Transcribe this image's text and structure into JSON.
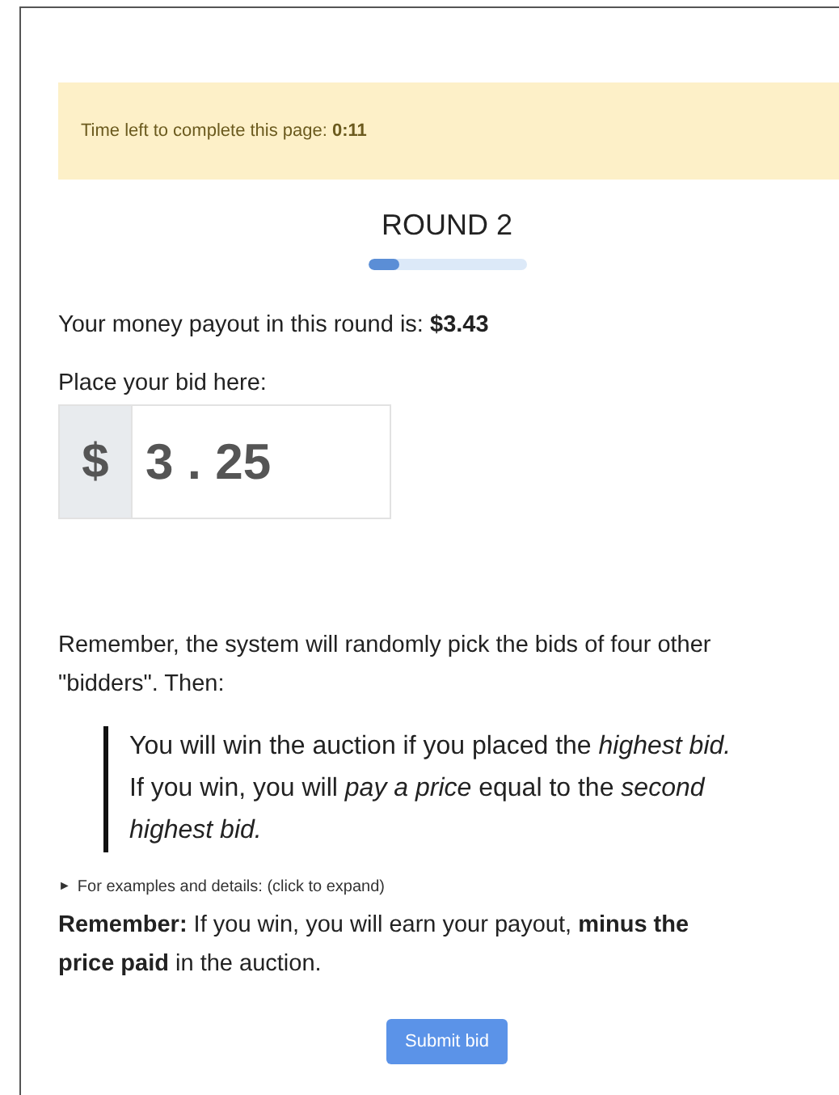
{
  "alert": {
    "text": "Time left to complete this page: **0:11**"
  },
  "round": {
    "title": "ROUND 2",
    "level": 0.2
  },
  "payout": {
    "text": "Your money payout in this round is: **$3.43**"
  },
  "bid": {
    "label": "Place your bid here:",
    "prefix": "$",
    "value": "3 . 25"
  },
  "reminder": "Remember, the system will randomly pick the bids of four other \"bidders\". Then:",
  "rules": "You will win the auction if you placed the *highest bid.* If you win, you will *pay a price* equal to the *second highest bid.*",
  "details": {
    "marker": "►",
    "summary": "For examples and details: (click to expand)",
    "expanded": false
  },
  "note": "**Remember:** If you win, you will earn your payout, **minus the price paid** in the auction.",
  "button": "Submit bid"
}
